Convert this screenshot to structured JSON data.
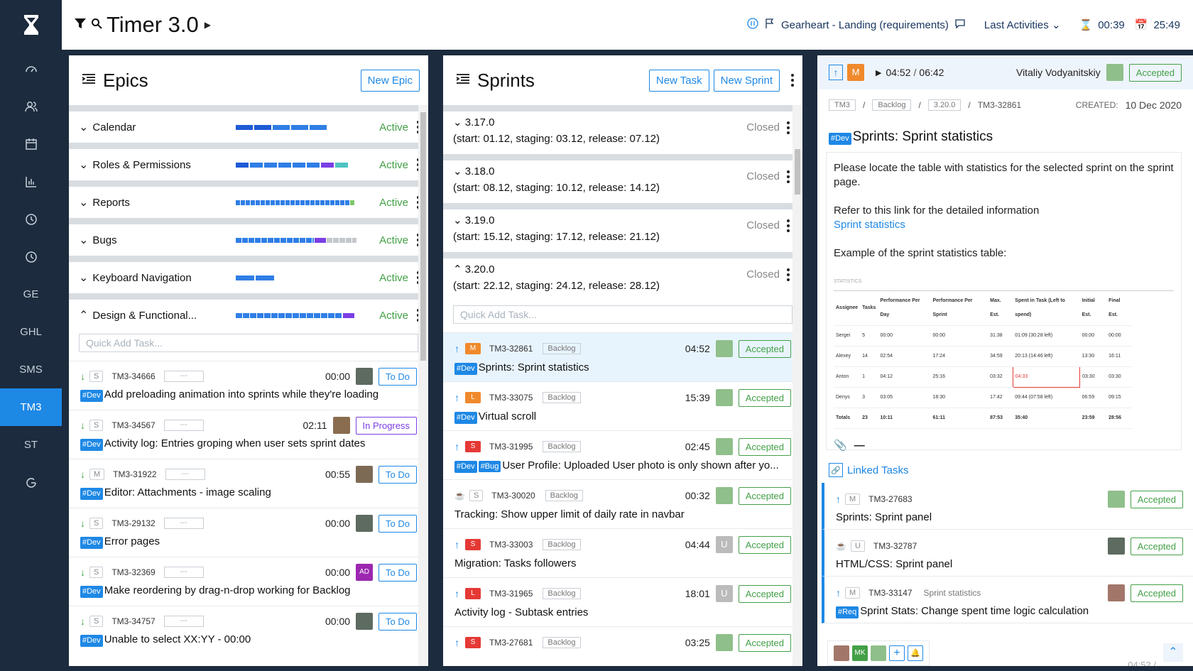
{
  "app": {
    "title": "Timer 3.0",
    "project": "Gearheart - Landing (requirements)",
    "last_activities": "Last Activities",
    "timer1": "00:39",
    "timer2": "25:49"
  },
  "sidebar": {
    "items": [
      {
        "label": "",
        "icon": "dashboard-icon"
      },
      {
        "label": "",
        "icon": "users-icon"
      },
      {
        "label": "",
        "icon": "calendar-icon"
      },
      {
        "label": "",
        "icon": "chart-icon"
      },
      {
        "label": "",
        "icon": "clock-icon"
      },
      {
        "label": "",
        "icon": "clock-icon"
      },
      {
        "label": "GE"
      },
      {
        "label": "GHL"
      },
      {
        "label": "SMS"
      },
      {
        "label": "TM3"
      },
      {
        "label": "ST"
      },
      {
        "label": "",
        "icon": "refresh-icon"
      }
    ]
  },
  "epics": {
    "title": "Epics",
    "new_epic": "New Epic",
    "quick_add": "Quick Add Task...",
    "items": [
      {
        "name": "Calendar",
        "status": "Active"
      },
      {
        "name": "Roles & Permissions",
        "status": "Active"
      },
      {
        "name": "Reports",
        "status": "Active"
      },
      {
        "name": "Bugs",
        "status": "Active"
      },
      {
        "name": "Keyboard Navigation",
        "status": "Active"
      },
      {
        "name": "Design & Functional...",
        "status": "Active"
      }
    ],
    "tasks": [
      {
        "size": "S",
        "id": "TM3-34666",
        "time": "00:00",
        "status": "To Do",
        "tag": "#Dev",
        "title": "Add preloading animation into sprints while they're loading"
      },
      {
        "size": "S",
        "id": "TM3-34567",
        "time": "02:11",
        "status": "In Progress",
        "tag": "#Dev",
        "title": "Activity log: Entries groping when user sets sprint dates"
      },
      {
        "size": "M",
        "id": "TM3-31922",
        "time": "00:55",
        "status": "To Do",
        "tag": "#Dev",
        "title": "Editor: Attachments - image scaling"
      },
      {
        "size": "S",
        "id": "TM3-29132",
        "time": "00:00",
        "status": "To Do",
        "tag": "#Dev",
        "title": "Error pages"
      },
      {
        "size": "S",
        "id": "TM3-32369",
        "time": "00:00",
        "status": "To Do",
        "tag": "#Dev",
        "title": "Make reordering by drag-n-drop working for Backlog",
        "avatar": "AD"
      },
      {
        "size": "S",
        "id": "TM3-34757",
        "time": "00:00",
        "status": "To Do",
        "tag": "#Dev",
        "title": "Unable to select XX:YY - 00:00"
      }
    ],
    "dash": "---"
  },
  "sprints": {
    "title": "Sprints",
    "new_task": "New Task",
    "new_sprint": "New Sprint",
    "quick_add": "Quick Add Task...",
    "items": [
      {
        "name": "3.17.0",
        "dates": "(start: 01.12, staging: 03.12, release: 07.12)",
        "status": "Closed"
      },
      {
        "name": "3.18.0",
        "dates": "(start: 08.12, staging: 10.12, release: 14.12)",
        "status": "Closed"
      },
      {
        "name": "3.19.0",
        "dates": "(start: 15.12, staging: 17.12, release: 21.12)",
        "status": "Closed"
      },
      {
        "name": "3.20.0",
        "dates": "(start: 22.12, staging: 24.12, release: 28.12)",
        "status": "Closed"
      }
    ],
    "tasks": [
      {
        "prio": "M",
        "id": "TM3-32861",
        "backlog": "Backlog",
        "time": "04:52",
        "status": "Accepted",
        "tag": "#Dev",
        "title": "Sprints: Sprint statistics"
      },
      {
        "prio": "L",
        "id": "TM3-33075",
        "backlog": "Backlog",
        "time": "15:39",
        "status": "Accepted",
        "tag": "#Dev",
        "title": "Virtual scroll"
      },
      {
        "prio": "S",
        "id": "TM3-31995",
        "backlog": "Backlog",
        "time": "02:45",
        "status": "Accepted",
        "tag": "#Dev",
        "tag2": "#Bug",
        "title": "User Profile: Uploaded User photo is only shown after yo..."
      },
      {
        "prio": "S",
        "id": "TM3-30020",
        "backlog": "Backlog",
        "time": "00:32",
        "status": "Accepted",
        "title": "Tracking: Show upper limit of daily rate in navbar"
      },
      {
        "prio": "S",
        "id": "TM3-33003",
        "backlog": "Backlog",
        "time": "04:44",
        "status": "Accepted",
        "title": "Migration: Tasks followers",
        "avatar": "U"
      },
      {
        "prio": "L",
        "id": "TM3-31965",
        "backlog": "Backlog",
        "time": "18:01",
        "status": "Accepted",
        "title": "Activity log - Subtask entries",
        "avatar": "U"
      },
      {
        "prio": "S",
        "id": "TM3-27681",
        "backlog": "Backlog",
        "time": "03:25",
        "status": "Accepted",
        "title": ""
      }
    ]
  },
  "detail": {
    "prio": "M",
    "time_spent": "04:52",
    "time_total": "06:42",
    "assignee": "Vitaliy Vodyanitskiy",
    "status": "Accepted",
    "crumb_project": "TM3",
    "crumb_backlog": "Backlog",
    "crumb_version": "3.20.0",
    "crumb_id": "TM3-32861",
    "created_label": "CREATED:",
    "created": "10 Dec 2020",
    "tag": "#Dev",
    "title": "Sprints: Sprint statistics",
    "p1": "Please locate the table with statistics for the selected sprint on the sprint page.",
    "p2": "Refer to this link for the detailed information",
    "link": "Sprint statistics",
    "p3": "Example of the sprint statistics table:",
    "table_label": "STATISTICS",
    "table_headers": [
      "Assignee",
      "Tasks",
      "Performance Per Day",
      "Performance Per Sprint",
      "Max. Est.",
      "Spent in Task (Left to spend)",
      "Initial Est.",
      "Final Est."
    ],
    "table_rows": [
      [
        "Sergei",
        "5",
        "00:00",
        "00:00",
        "31:38",
        "01:09 (30:28 left)",
        "00:00",
        "00:00"
      ],
      [
        "Alexey",
        "14",
        "02:54",
        "17:24",
        "34:59",
        "20:13 (14:46 left)",
        "13:30",
        "16:11"
      ],
      [
        "Anton",
        "1",
        "04:12",
        "25:16",
        "03:32",
        "04:33",
        "03:30",
        "03:30"
      ],
      [
        "Denys",
        "3",
        "03:05",
        "18:30",
        "17:42",
        "09:44 (07:58 left)",
        "06:59",
        "09:15"
      ],
      [
        "Totals",
        "23",
        "10:11",
        "61:11",
        "87:53",
        "35:40",
        "23:59",
        "28:56"
      ]
    ],
    "linked_title": "Linked Tasks",
    "linked": [
      {
        "size": "M",
        "id": "TM3-27683",
        "status": "Accepted",
        "title": "Sprints: Sprint panel"
      },
      {
        "size": "U",
        "id": "TM3-32787",
        "status": "Accepted",
        "title": "HTML/CSS: Sprint panel"
      },
      {
        "size": "M",
        "id": "TM3-33147",
        "epic": "Sprint statistics",
        "status": "Accepted",
        "tag": "#Req",
        "title": "Sprint Stats: Change spent time logic calculation"
      }
    ],
    "footer_initials": "MK",
    "footer_time": "04:52 /"
  }
}
